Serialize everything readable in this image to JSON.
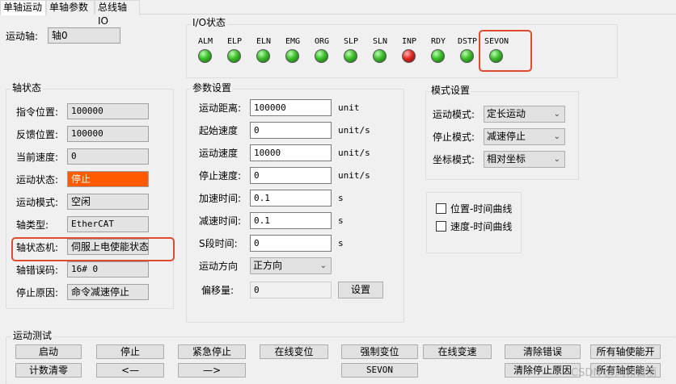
{
  "tabs": [
    "单轴运动",
    "单轴参数",
    "总线轴IO"
  ],
  "axis_select": {
    "label": "运动轴:",
    "value": "轴0"
  },
  "io_status": {
    "title": "I/O状态",
    "signals": [
      {
        "name": "ALM",
        "state": "green"
      },
      {
        "name": "ELP",
        "state": "green"
      },
      {
        "name": "ELN",
        "state": "green"
      },
      {
        "name": "EMG",
        "state": "green"
      },
      {
        "name": "ORG",
        "state": "green"
      },
      {
        "name": "SLP",
        "state": "green"
      },
      {
        "name": "SLN",
        "state": "green"
      },
      {
        "name": "INP",
        "state": "red"
      },
      {
        "name": "RDY",
        "state": "green"
      },
      {
        "name": "DSTP",
        "state": "green"
      },
      {
        "name": "SEVON",
        "state": "green"
      }
    ]
  },
  "axis_status": {
    "title": "轴状态",
    "rows": [
      {
        "label": "指令位置:",
        "value": "100000"
      },
      {
        "label": "反馈位置:",
        "value": "100000"
      },
      {
        "label": "当前速度:",
        "value": "0"
      },
      {
        "label": "运动状态:",
        "value": "停止",
        "color": "#ff5a00"
      },
      {
        "label": "运动模式:",
        "value": "空闲"
      },
      {
        "label": "轴类型:",
        "value": "EtherCAT"
      },
      {
        "label": "轴状态机:",
        "value": "伺服上电使能状态"
      },
      {
        "label": "轴错误码:",
        "value": "16# 0"
      },
      {
        "label": "停止原因:",
        "value": "命令减速停止"
      }
    ]
  },
  "params": {
    "title": "参数设置",
    "distance": {
      "label": "运动距离:",
      "value": "100000",
      "unit": "unit"
    },
    "start_speed": {
      "label": "起始速度",
      "value": "0",
      "unit": "unit/s"
    },
    "run_speed": {
      "label": "运动速度",
      "value": "10000",
      "unit": "unit/s"
    },
    "stop_speed": {
      "label": "停止速度:",
      "value": "0",
      "unit": "unit/s"
    },
    "accel_time": {
      "label": "加速时间:",
      "value": "0.1",
      "unit": "s"
    },
    "decel_time": {
      "label": "减速时间:",
      "value": "0.1",
      "unit": "s"
    },
    "s_time": {
      "label": "S段时间:",
      "value": "0",
      "unit": "s"
    },
    "direction": {
      "label": "运动方向",
      "value": "正方向"
    },
    "offset": {
      "label": "偏移量:",
      "value": "0",
      "button": "设置"
    }
  },
  "mode": {
    "title": "模式设置",
    "motion": {
      "label": "运动模式:",
      "value": "定长运动"
    },
    "stop": {
      "label": "停止模式:",
      "value": "减速停止"
    },
    "coord": {
      "label": "坐标模式:",
      "value": "相对坐标"
    }
  },
  "curves": {
    "pos_time": "位置-时间曲线",
    "speed_time": "速度-时间曲线"
  },
  "test": {
    "title": "运动测试",
    "row1": [
      "启动",
      "停止",
      "紧急停止",
      "在线变位",
      "强制变位",
      "在线变速",
      "清除错误",
      "所有轴使能开"
    ],
    "row2": [
      "计数清零",
      "<—",
      "—>",
      "SEVON",
      "清除停止原因",
      "所有轴使能关"
    ]
  },
  "watermark": "CSDN @风和日丽"
}
